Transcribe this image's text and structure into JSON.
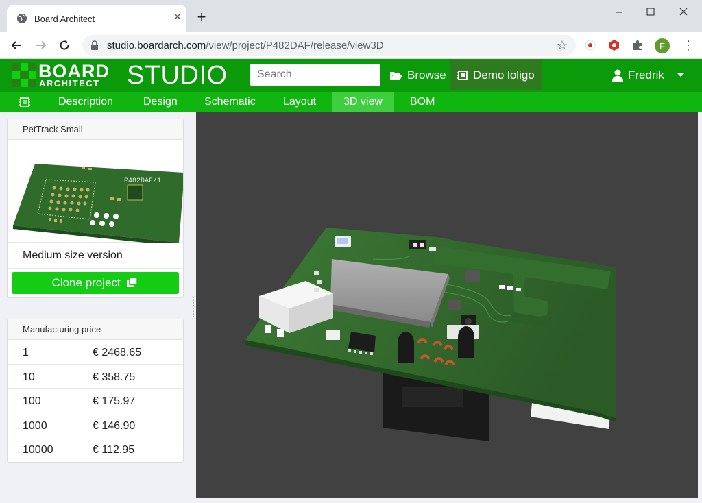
{
  "browser": {
    "tab_title": "Board Architect",
    "url_host": "studio.boardarch.com",
    "url_path": "/view/project/P482DAF/release/view3D",
    "profile_initial": "F"
  },
  "header": {
    "logo_board": "BOARD",
    "logo_architect": "ARCHITECT",
    "logo_studio": "STUDIO",
    "search_placeholder": "Search",
    "browse_label": "Browse",
    "demo_label": "Demo loligo",
    "user_name": "Fredrik"
  },
  "subnav": {
    "tabs": [
      {
        "label": "Description"
      },
      {
        "label": "Design"
      },
      {
        "label": "Schematic"
      },
      {
        "label": "Layout"
      },
      {
        "label": "3D view",
        "active": true
      },
      {
        "label": "BOM"
      }
    ]
  },
  "project": {
    "title": "PetTrack Small",
    "description": "Medium size version",
    "clone_label": "Clone project",
    "board_id": "P482DAF/1"
  },
  "pricing": {
    "title": "Manufacturing price",
    "rows": [
      {
        "qty": "1",
        "price": "€ 2468.65"
      },
      {
        "qty": "10",
        "price": "€ 358.75"
      },
      {
        "qty": "100",
        "price": "€ 175.97"
      },
      {
        "qty": "1000",
        "price": "€ 146.90"
      },
      {
        "qty": "10000",
        "price": "€ 112.95"
      }
    ]
  },
  "colors": {
    "header_green": "#0a9a0a",
    "subnav_green": "#10b510",
    "active_tab": "#3dcf3d",
    "button_green": "#14cc14",
    "pcb_green": "#2f6b2a",
    "viewport_bg": "#414141"
  }
}
